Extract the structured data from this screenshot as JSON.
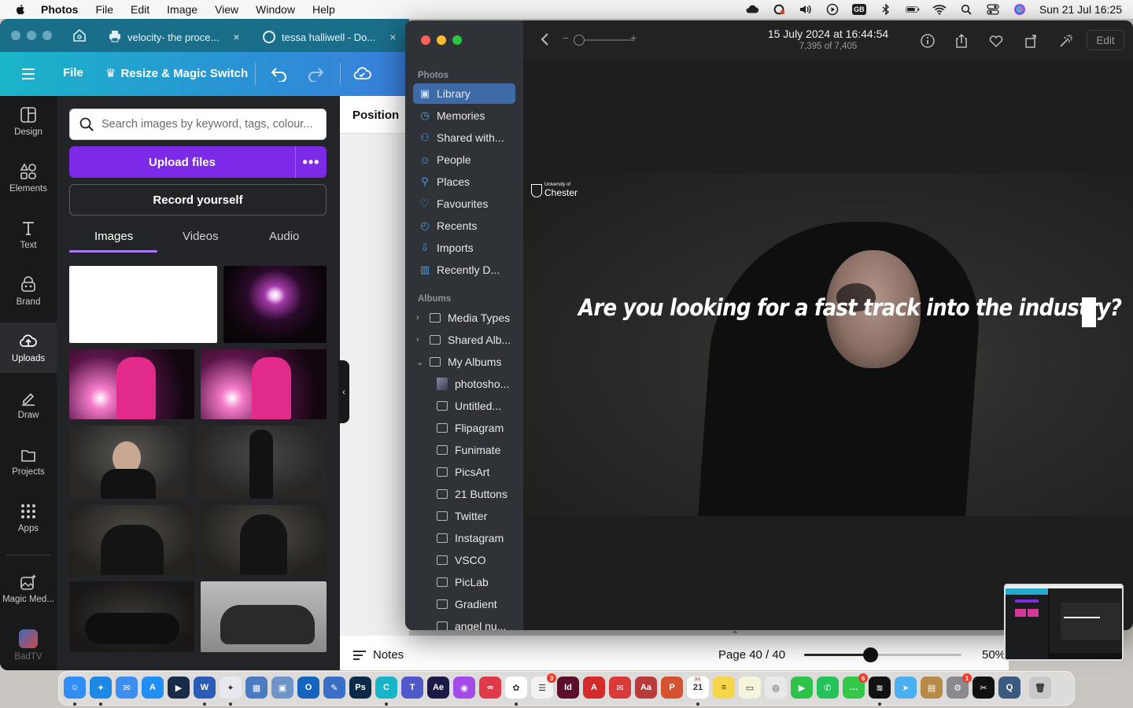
{
  "menubar": {
    "app_name": "Photos",
    "menus": [
      "File",
      "Edit",
      "Image",
      "View",
      "Window",
      "Help"
    ],
    "input_source": "GB",
    "clock": "Sun 21 Jul  16:25"
  },
  "browser": {
    "tabs": [
      {
        "title": "velocity- the proce...",
        "close": "×"
      },
      {
        "title": "tessa halliwell - Do...",
        "close": "×"
      }
    ]
  },
  "canva": {
    "toolbar": {
      "file": "File",
      "resize": "Resize & Magic Switch"
    },
    "rail": [
      {
        "label": "Design",
        "icon": "design-icon"
      },
      {
        "label": "Elements",
        "icon": "elements-icon"
      },
      {
        "label": "Text",
        "icon": "text-icon"
      },
      {
        "label": "Brand",
        "icon": "brand-icon"
      },
      {
        "label": "Uploads",
        "icon": "uploads-icon"
      },
      {
        "label": "Draw",
        "icon": "draw-icon"
      },
      {
        "label": "Projects",
        "icon": "projects-icon"
      },
      {
        "label": "Apps",
        "icon": "apps-icon"
      },
      {
        "label": "Magic Med...",
        "icon": "magic-media-icon"
      },
      {
        "label": "BadTV",
        "icon": "badtv-icon"
      }
    ],
    "search_placeholder": "Search images by keyword, tags, colour...",
    "upload_label": "Upload files",
    "more_label": "•••",
    "record_label": "Record yourself",
    "media_tabs": [
      "Images",
      "Videos",
      "Audio"
    ],
    "position_label": "Position",
    "collapse_glyph": "‹",
    "notes_label": "Notes",
    "page_counter": "Page 40 / 40",
    "zoom": "50%",
    "zoom_fraction": 0.42
  },
  "photos": {
    "section_photos": "Photos",
    "library_items": [
      {
        "label": "Library",
        "icon": "library-icon"
      },
      {
        "label": "Memories",
        "icon": "memories-icon"
      },
      {
        "label": "Shared with...",
        "icon": "shared-icon"
      },
      {
        "label": "People",
        "icon": "people-icon"
      },
      {
        "label": "Places",
        "icon": "places-icon"
      },
      {
        "label": "Favourites",
        "icon": "heart-icon"
      },
      {
        "label": "Recents",
        "icon": "clock-icon"
      },
      {
        "label": "Imports",
        "icon": "import-icon"
      },
      {
        "label": "Recently D...",
        "icon": "trash-icon"
      }
    ],
    "section_albums": "Albums",
    "albums": [
      {
        "label": "Media Types",
        "expander": "›"
      },
      {
        "label": "Shared Alb...",
        "expander": "›"
      },
      {
        "label": "My Albums",
        "expander": "⌄"
      }
    ],
    "my_albums": [
      "photosho...",
      "Untitled...",
      "Flipagram",
      "Funimate",
      "PicsArt",
      "21 Buttons",
      "Twitter",
      "Instagram",
      "VSCO",
      "PicLab",
      "Gradient",
      "angel nu..."
    ],
    "date": "15 July 2024 at 16:44:54",
    "count": "7,395 of 7,405",
    "edit_label": "Edit",
    "zoom_minus": "−",
    "zoom_plus": "+",
    "caption": "Are you looking for a fast track into the industry?",
    "logo_small": "University of",
    "logo_name": "Chester"
  },
  "dock": {
    "apps": [
      {
        "name": "finder-icon",
        "color": "#2f8df5",
        "glyph": "☺"
      },
      {
        "name": "safari-icon",
        "color": "#1e88e5",
        "glyph": "✦"
      },
      {
        "name": "mail-icon",
        "color": "#3d8ef0",
        "glyph": "✉"
      },
      {
        "name": "appstore-icon",
        "color": "#1f8ff5",
        "glyph": "A"
      },
      {
        "name": "primevideo-icon",
        "color": "#1a2b4a",
        "glyph": "▶"
      },
      {
        "name": "word-icon",
        "color": "#2b5cb8",
        "glyph": "W"
      },
      {
        "name": "butterfly-icon",
        "color": "#e8e8ee",
        "glyph": "✦"
      },
      {
        "name": "screens-icon",
        "color": "#4a7ac0",
        "glyph": "▦"
      },
      {
        "name": "preview-icon",
        "color": "#6f94c8",
        "glyph": "▣"
      },
      {
        "name": "outlook-icon",
        "color": "#1565c0",
        "glyph": "O"
      },
      {
        "name": "feather-icon",
        "color": "#3a6fc8",
        "glyph": "✎"
      },
      {
        "name": "photoshop-icon",
        "color": "#0b2a4a",
        "glyph": "Ps"
      },
      {
        "name": "canva-icon",
        "color": "#18b5c8",
        "glyph": "C"
      },
      {
        "name": "teams-icon",
        "color": "#5059c9",
        "glyph": "T"
      },
      {
        "name": "aftereffects-icon",
        "color": "#1b1947",
        "glyph": "Ae"
      },
      {
        "name": "podcasts-icon",
        "color": "#a24be8",
        "glyph": "◉"
      },
      {
        "name": "creativecloud-icon",
        "color": "#e03a4a",
        "glyph": "∞"
      },
      {
        "name": "photos-icon",
        "color": "#ffffff",
        "glyph": "✿"
      },
      {
        "name": "reminders-icon",
        "color": "#f2f2f2",
        "glyph": "☰"
      },
      {
        "name": "indesign-icon",
        "color": "#5a0f2a",
        "glyph": "Id"
      },
      {
        "name": "acrobat-icon",
        "color": "#d42a2a",
        "glyph": "A"
      },
      {
        "name": "airmail-icon",
        "color": "#d83a3a",
        "glyph": "✉"
      },
      {
        "name": "dictionary-icon",
        "color": "#b83a3a",
        "glyph": "Aa"
      },
      {
        "name": "powerpoint-icon",
        "color": "#d35230",
        "glyph": "P"
      },
      {
        "name": "calendar-icon",
        "color": "#ffffff",
        "glyph": "21"
      },
      {
        "name": "notes-icon",
        "color": "#f6d64a",
        "glyph": "≡"
      },
      {
        "name": "stickies-icon",
        "color": "#f5f5dc",
        "glyph": "▭"
      },
      {
        "name": "chrome-icon",
        "color": "#e8e8e8",
        "glyph": "◎"
      },
      {
        "name": "facetime-icon",
        "color": "#2fc24a",
        "glyph": "▶"
      },
      {
        "name": "whatsapp-icon",
        "color": "#25c25a",
        "glyph": "✆"
      },
      {
        "name": "messages-icon",
        "color": "#34c84a",
        "glyph": "…"
      },
      {
        "name": "spotify-icon",
        "color": "#121212",
        "glyph": "≋"
      },
      {
        "name": "maps-icon",
        "color": "#4ab0f0",
        "glyph": "➤"
      },
      {
        "name": "keka-icon",
        "color": "#b88a4a",
        "glyph": "▤"
      },
      {
        "name": "settings-icon",
        "color": "#8a8a8e",
        "glyph": "⚙"
      },
      {
        "name": "capcut-icon",
        "color": "#111111",
        "glyph": "✂"
      },
      {
        "name": "quicktime-icon",
        "color": "#3a5a80",
        "glyph": "Q"
      },
      {
        "name": "trash-icon",
        "color": "#c8c8c8",
        "glyph": "🗑"
      }
    ],
    "badges": {
      "reminders": "3",
      "messages": "6",
      "settings": "1"
    },
    "calendar_month": "JUL"
  }
}
